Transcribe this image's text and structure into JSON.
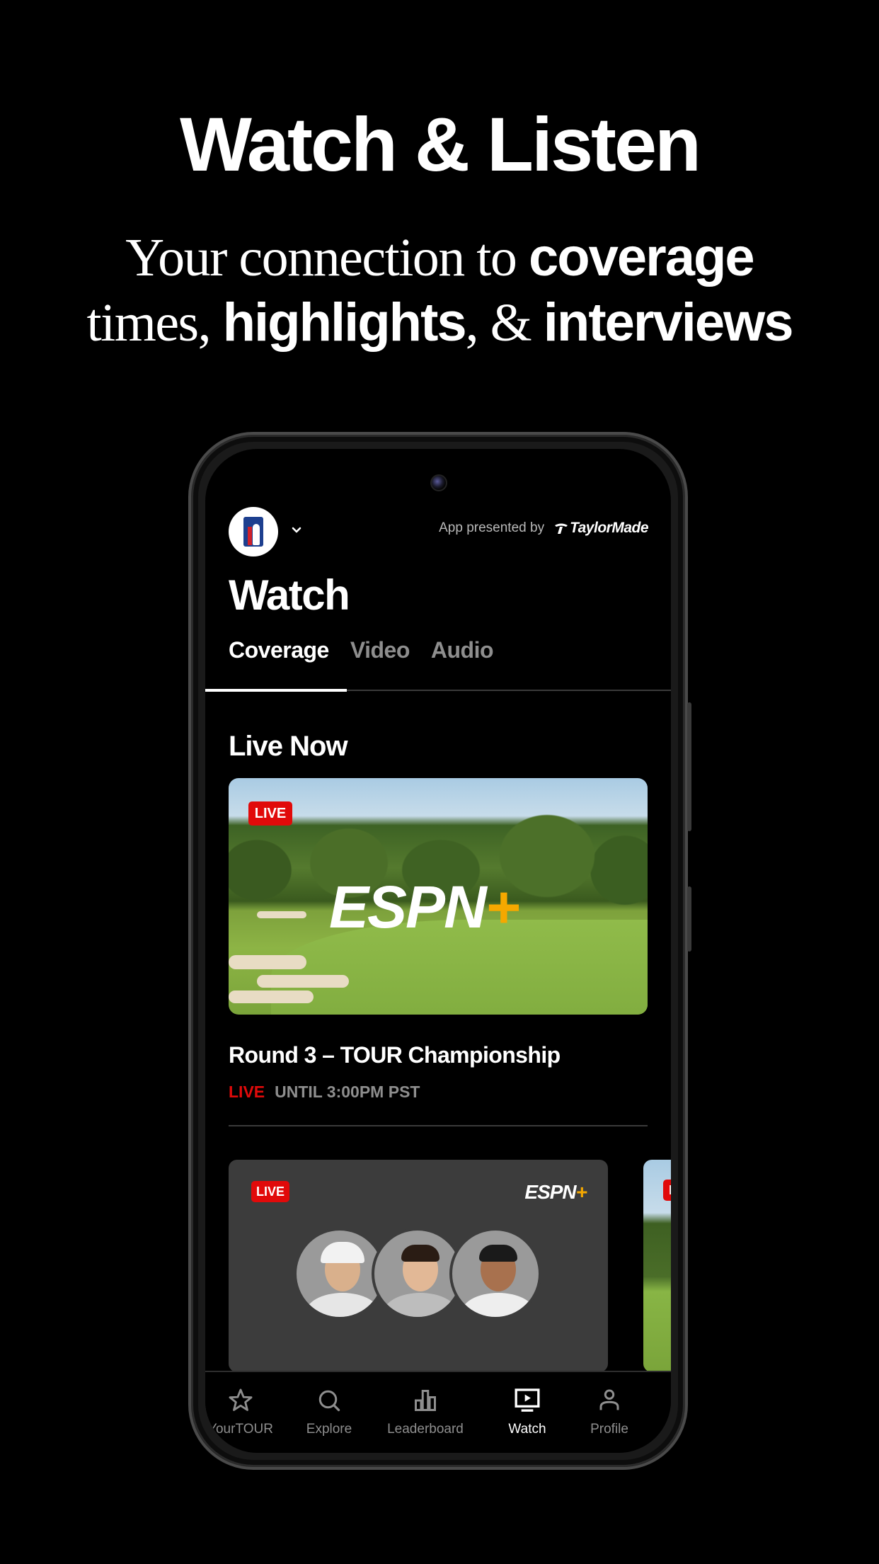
{
  "hero": {
    "title": "Watch & Listen",
    "subtitle_line1": [
      {
        "text": "Your connection to ",
        "style": "serif"
      },
      {
        "text": "coverage",
        "style": "bold"
      }
    ],
    "subtitle_line2": [
      {
        "text": "times, ",
        "style": "serif"
      },
      {
        "text": "highlights",
        "style": "bold"
      },
      {
        "text": ", & ",
        "style": "serif"
      },
      {
        "text": "interviews",
        "style": "bold"
      }
    ]
  },
  "app": {
    "header": {
      "logo": "pga-tour-logo",
      "switcher_icon": "chevron-down-icon",
      "presented_by_label": "App presented by",
      "sponsor": "TaylorMade"
    },
    "page_title": "Watch",
    "tabs": [
      {
        "label": "Coverage",
        "active": true
      },
      {
        "label": "Video",
        "active": false
      },
      {
        "label": "Audio",
        "active": false
      }
    ],
    "section_title": "Live Now",
    "featured": {
      "badge": "LIVE",
      "network": "ESPN",
      "network_plus": "+",
      "title": "Round 3 – TOUR Championship",
      "status": "LIVE",
      "status_detail": "UNTIL 3:00PM PST"
    },
    "cards": [
      {
        "badge": "LIVE",
        "network": "ESPN",
        "network_plus": "+",
        "players": 3
      },
      {
        "badge": "LIVE"
      }
    ],
    "bottom_nav": [
      {
        "label": "YourTOUR",
        "icon": "star-icon",
        "active": false
      },
      {
        "label": "Explore",
        "icon": "search-icon",
        "active": false
      },
      {
        "label": "Leaderboard",
        "icon": "bar-chart-icon",
        "active": false
      },
      {
        "label": "Watch",
        "icon": "tv-play-icon",
        "active": true
      },
      {
        "label": "Profile",
        "icon": "person-icon",
        "active": false
      }
    ]
  },
  "colors": {
    "live_red": "#e10a0a",
    "espn_plus_gold": "#f5a800",
    "inactive_gray": "#8e8e8e",
    "card_dark": "#3c3c3c"
  }
}
